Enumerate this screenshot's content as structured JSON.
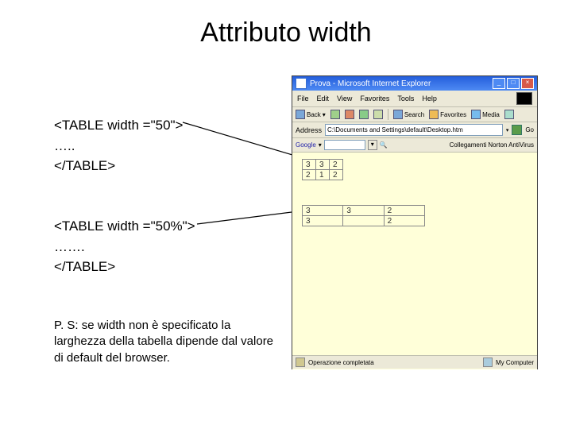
{
  "title": "Attributo width",
  "code_block_1": {
    "line1": "<TABLE  width =\"50\">",
    "line2": "…..",
    "line3": "</TABLE>"
  },
  "code_block_2": {
    "line1": "<TABLE  width =\"50%\">",
    "line2": "…….",
    "line3": "</TABLE>"
  },
  "ps": {
    "prefix": "P. S: ",
    "rest": "se width non è specificato la larghezza della tabella dipende dal valore di default del browser."
  },
  "ie": {
    "title": "Prova - Microsoft Internet Explorer",
    "menubar": [
      "File",
      "Edit",
      "View",
      "Favorites",
      "Tools",
      "Help"
    ],
    "toolbar": {
      "back": "Back",
      "search": "Search",
      "favorites": "Favorites",
      "media": "Media"
    },
    "address_label": "Address",
    "address_value": "C:\\Documents and Settings\\default\\Desktop.htm",
    "google_label": "Google",
    "google_links": "Collegamenti",
    "norton": "Norton AntiVirus",
    "status_left": "Operazione completata",
    "status_right": "My Computer"
  },
  "tables": {
    "t1": {
      "rows": [
        [
          "3",
          "3",
          "2"
        ],
        [
          "2",
          "1",
          "2"
        ]
      ]
    },
    "t2": {
      "rows": [
        [
          "3",
          "3",
          "2"
        ],
        [
          "3",
          "",
          "2"
        ]
      ]
    }
  }
}
